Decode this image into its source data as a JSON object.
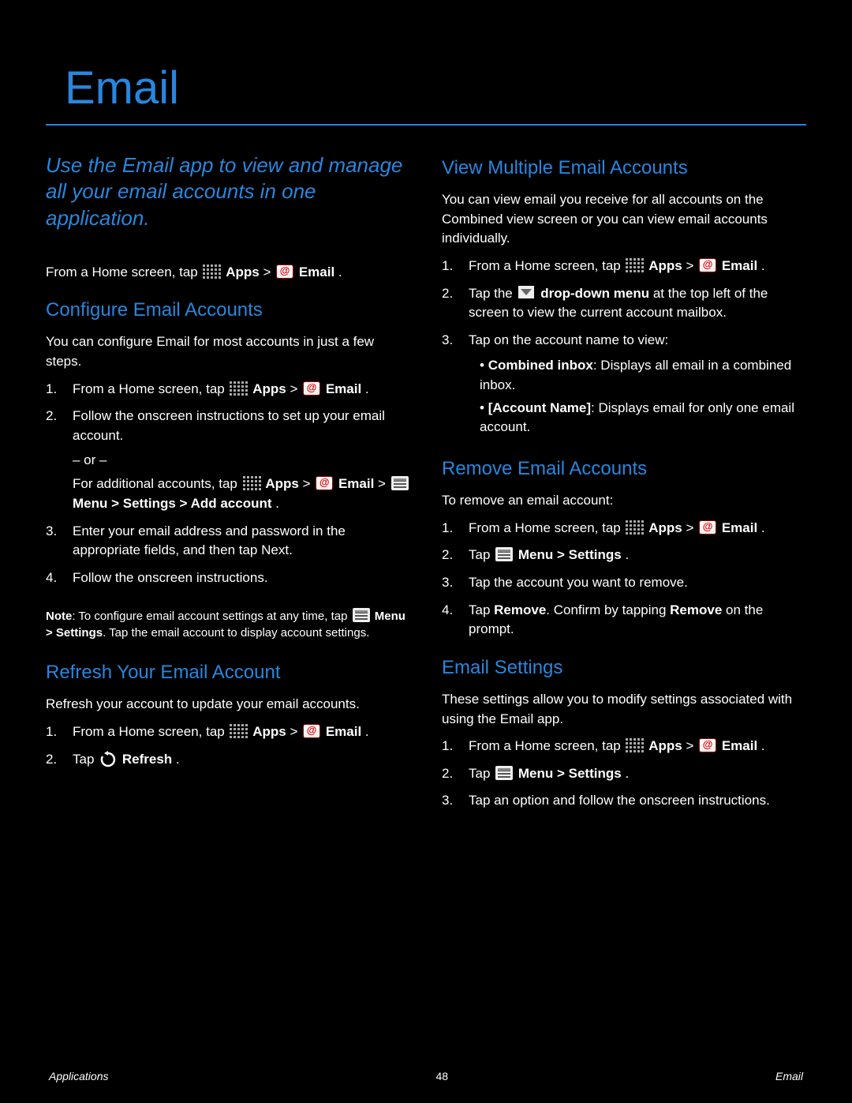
{
  "title": "Email",
  "intro": "Use the Email app to view and manage all your email accounts in one application.",
  "home_line_1": "From a Home screen, tap ",
  "apps_label": " Apps",
  "arrow": " > ",
  "email_label": " Email",
  "period": ".",
  "configure": {
    "heading": "Configure Email Accounts",
    "intro": "You can configure Email for most accounts in just a few steps.",
    "step1_a": "From a Home screen, tap ",
    "step2": "Follow the onscreen instructions to set up your email account.",
    "or": "– or –",
    "step2b_a": "For additional accounts, tap ",
    "step2b_b": " Menu > Settings > Add account",
    "step3": "Enter your email address and password in the appropriate fields, and then tap Next.",
    "step4": "Follow the onscreen instructions.",
    "note_a": "Note",
    "note_b": ": To configure email account settings at any time, tap ",
    "note_c": " Menu > Settings",
    "note_d": ". Tap the email account to display account settings."
  },
  "refresh": {
    "heading": "Refresh Your Email Account",
    "intro": "Refresh your account to update your email accounts.",
    "step1_a": "From a Home screen, tap ",
    "step2_a": "Tap ",
    "step2_b": " Refresh"
  },
  "view": {
    "heading": "View Multiple Email Accounts",
    "intro": "You can view email you receive for all accounts on the Combined view screen or you can view email accounts individually.",
    "step1_a": "From a Home screen, tap ",
    "step2_a": "Tap the ",
    "step2_b": " drop-down menu",
    "step2_c": " at the top left of the screen to view the current account mailbox.",
    "step3": "Tap on the account name to view:",
    "bullet1_a": "Combined inbox",
    "bullet1_b": ": Displays all email in a combined inbox.",
    "bullet2_a": "[Account Name]",
    "bullet2_b": ": Displays email for only one email account."
  },
  "remove": {
    "heading": "Remove Email Accounts",
    "intro": "To remove an email account:",
    "step1_a": "From a Home screen, tap ",
    "step2_a": "Tap ",
    "step2_b": " Menu > Settings",
    "step3": "Tap the account you want to remove.",
    "step4_a": "Tap ",
    "step4_b": "Remove",
    "step4_c": ". Confirm by tapping ",
    "step4_d": "Remove",
    "step4_e": " on the prompt."
  },
  "settings": {
    "heading": "Email Settings",
    "intro": "These settings allow you to modify settings associated with using the Email app.",
    "step1_a": "From a Home screen, tap ",
    "step2_a": "Tap ",
    "step2_b": " Menu > Settings",
    "step3": "Tap an option and follow the onscreen instructions."
  },
  "footer": {
    "left": "Applications",
    "page": "48",
    "right": "Email"
  },
  "labels": {
    "apps": "Apps",
    "email": "Email"
  }
}
